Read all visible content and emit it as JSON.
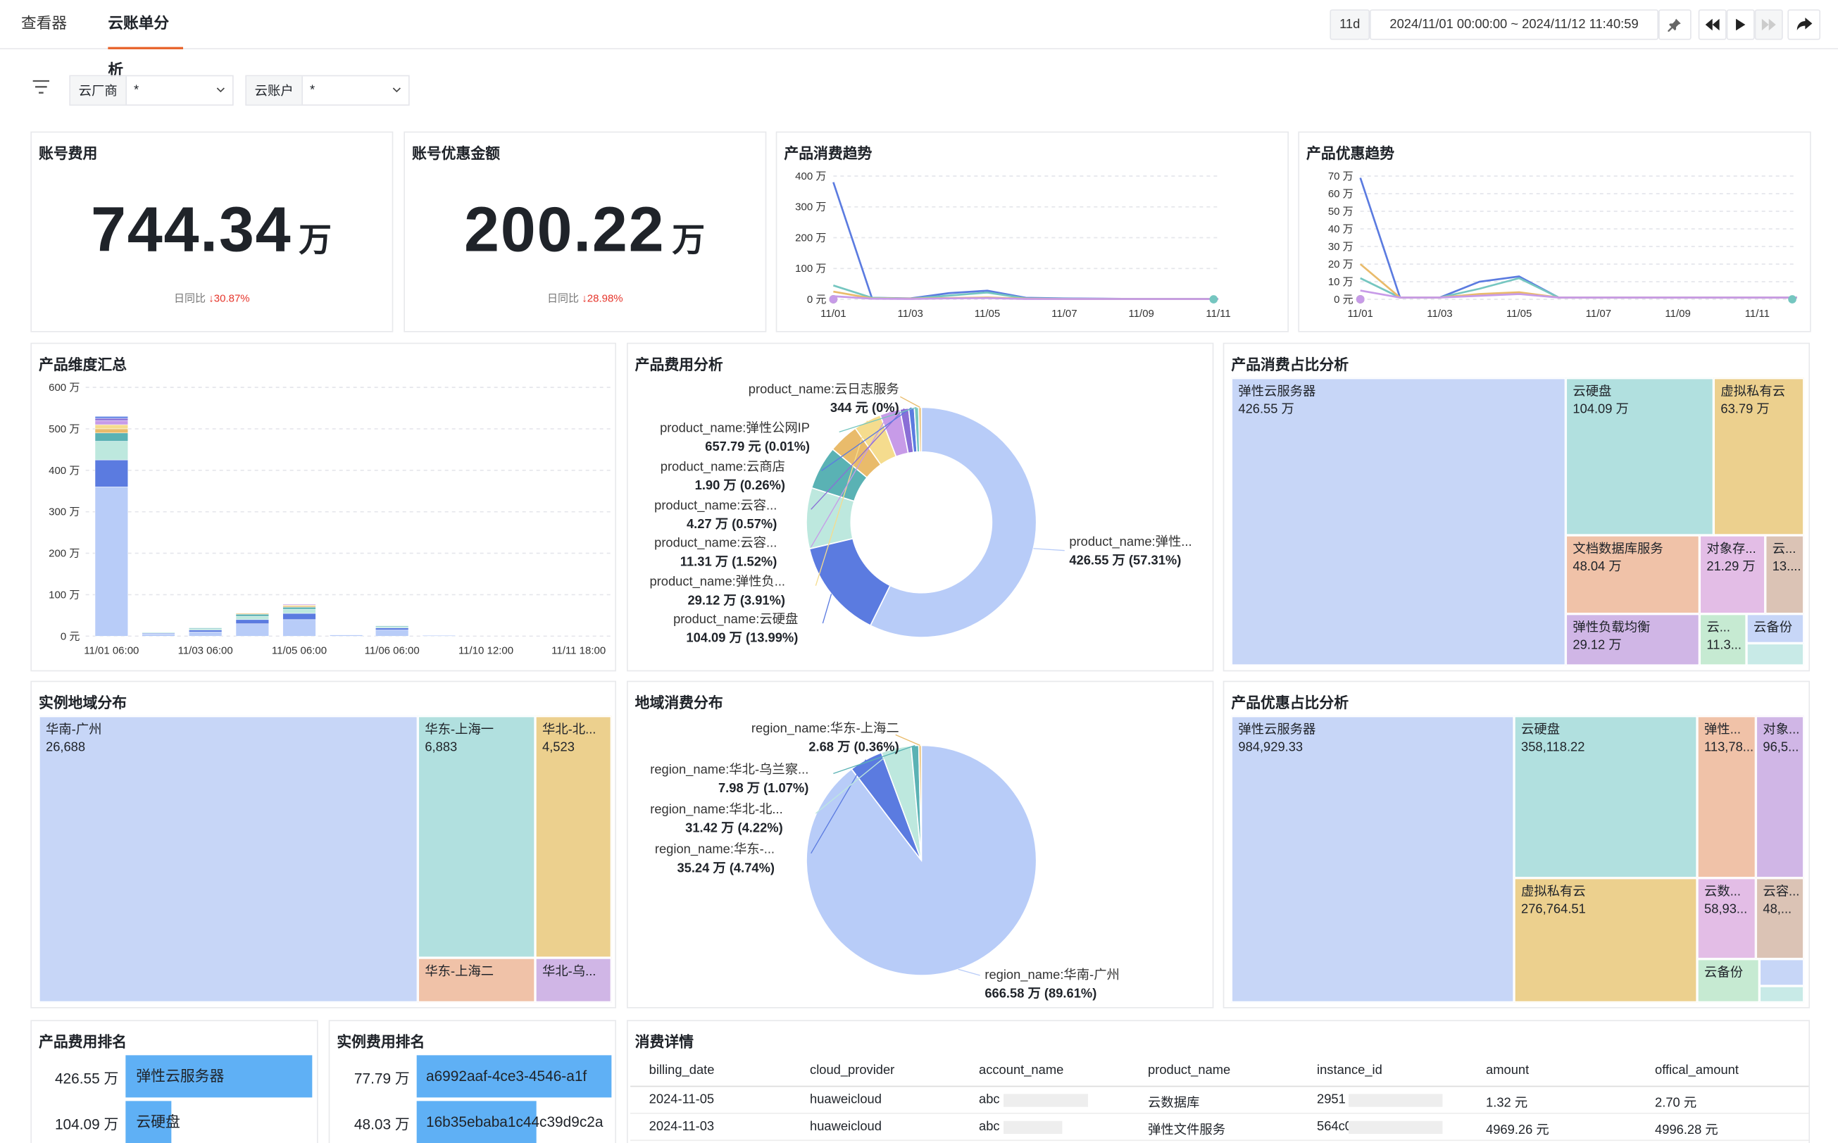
{
  "tabs": [
    {
      "label": "查看器"
    },
    {
      "label": "云账单分析"
    }
  ],
  "toolbar": {
    "range_short": "11d",
    "time_range": "2024/11/01 00:00:00 ~ 2024/11/12 11:40:59"
  },
  "filters": [
    {
      "label": "云厂商",
      "value": "*"
    },
    {
      "label": "云账户",
      "value": "*"
    }
  ],
  "cards": [
    {
      "title": "账号费用",
      "value": "744.34",
      "unit": "万",
      "compare_label": "日同比",
      "compare_value": "30.87%"
    },
    {
      "title": "账号优惠金额",
      "value": "200.22",
      "unit": "万",
      "compare_label": "日同比",
      "compare_value": "28.98%"
    }
  ],
  "panel_titles": {
    "consume_trend": "产品消费趋势",
    "discount_trend": "产品优惠趋势",
    "product_summary": "产品维度汇总",
    "product_cost": "产品费用分析",
    "product_share": "产品消费占比分析",
    "instance_region": "实例地域分布",
    "region_consume": "地域消费分布",
    "discount_share": "产品优惠占比分析",
    "product_rank": "产品费用排名",
    "instance_rank": "实例费用排名",
    "detail": "消费详情"
  },
  "chart_data": [
    {
      "type": "line",
      "title": "产品消费趋势",
      "x_ticks": [
        "11/01",
        "11/03",
        "11/05",
        "11/07",
        "11/09",
        "11/11"
      ],
      "y_ticks": [
        "0 元",
        "100 万",
        "200 万",
        "300 万",
        "400 万"
      ],
      "ylim": [
        0,
        400
      ],
      "x": [
        "11/01",
        "11/02",
        "11/03",
        "11/04",
        "11/05",
        "11/06",
        "11/07",
        "11/08",
        "11/09",
        "11/10",
        "11/11"
      ],
      "series": [
        {
          "color": "#5b7be0",
          "values": [
            380,
            5,
            3,
            20,
            28,
            5,
            3,
            2,
            1,
            1,
            1
          ]
        },
        {
          "color": "#75c6c0",
          "values": [
            45,
            5,
            2,
            12,
            22,
            3,
            2,
            1,
            1,
            1,
            1
          ]
        },
        {
          "color": "#e9bb6b",
          "values": [
            25,
            3,
            2,
            4,
            6,
            2,
            1,
            1,
            1,
            1,
            1
          ]
        },
        {
          "color": "#c79be8",
          "values": [
            10,
            2,
            1,
            3,
            4,
            1,
            1,
            1,
            1,
            1,
            1
          ]
        }
      ]
    },
    {
      "type": "line",
      "title": "产品优惠趋势",
      "x_ticks": [
        "11/01",
        "11/03",
        "11/05",
        "11/07",
        "11/09",
        "11/11"
      ],
      "y_ticks": [
        "0 元",
        "10 万",
        "20 万",
        "30 万",
        "40 万",
        "50 万",
        "60 万",
        "70 万"
      ],
      "ylim": [
        0,
        70
      ],
      "x": [
        "11/01",
        "11/02",
        "11/03",
        "11/04",
        "11/05",
        "11/06",
        "11/07",
        "11/08",
        "11/09",
        "11/10",
        "11/11",
        "11/12"
      ],
      "series": [
        {
          "color": "#5b7be0",
          "values": [
            69,
            1,
            1,
            10,
            13,
            1,
            1,
            1,
            1,
            1,
            1,
            1
          ]
        },
        {
          "color": "#75c6c0",
          "values": [
            12,
            1,
            1,
            6,
            12,
            1,
            1,
            1,
            1,
            1,
            1,
            1
          ]
        },
        {
          "color": "#e9bb6b",
          "values": [
            20,
            1,
            1,
            3,
            4,
            1,
            1,
            1,
            1,
            1,
            1,
            1
          ]
        },
        {
          "color": "#c79be8",
          "values": [
            5,
            1,
            1,
            2,
            3,
            1,
            1,
            1,
            1,
            1,
            1,
            1
          ]
        }
      ]
    },
    {
      "type": "bar",
      "title": "产品维度汇总",
      "x_ticks": [
        "11/01 06:00",
        "11/03 06:00",
        "11/05 06:00",
        "11/06 06:00",
        "11/10 12:00",
        "11/11 18:00"
      ],
      "y_ticks": [
        "0 元",
        "100 万",
        "200 万",
        "300 万",
        "400 万",
        "500 万",
        "600 万"
      ],
      "ylim": [
        0,
        600
      ],
      "stack_colors": [
        "#b8ccf8",
        "#5b7be0",
        "#bde8de",
        "#5ab2b4",
        "#e9bb6b",
        "#f5dc8e",
        "#c79be8",
        "#8a6ed6",
        "#6b8de6"
      ],
      "stacks": [
        [
          360,
          65,
          45,
          20,
          10,
          10,
          10,
          5,
          5
        ],
        [
          5,
          2,
          2,
          0,
          0,
          0,
          0,
          0,
          0
        ],
        [
          10,
          5,
          3,
          2,
          0,
          0,
          0,
          0,
          0
        ],
        [
          30,
          10,
          8,
          5,
          2,
          0,
          0,
          0,
          0
        ],
        [
          40,
          15,
          10,
          5,
          3,
          2,
          2,
          0,
          0
        ],
        [
          3,
          0,
          0,
          0,
          0,
          0,
          0,
          0,
          0
        ],
        [
          15,
          5,
          3,
          2,
          0,
          0,
          0,
          0,
          0
        ],
        [
          2,
          0,
          0,
          0,
          0,
          0,
          0,
          0,
          0
        ]
      ]
    },
    {
      "type": "pie",
      "title": "产品费用分析",
      "donut": true,
      "slices": [
        {
          "label": "product_name:弹性...",
          "value_text": "426.55 万 (57.31%)",
          "pct": 57.31,
          "color": "#b8ccf8"
        },
        {
          "label": "product_name:云硬盘",
          "value_text": "104.09 万 (13.99%)",
          "pct": 13.99,
          "color": "#5b7be0"
        },
        {
          "label": "",
          "value_text": "",
          "pct": 8.55,
          "color": "#bde8de"
        },
        {
          "label": "",
          "value_text": "",
          "pct": 6.12,
          "color": "#5ab2b4"
        },
        {
          "label": "",
          "value_text": "",
          "pct": 4.28,
          "color": "#e9bb6b"
        },
        {
          "label": "product_name:弹性负...",
          "value_text": "29.12 万 (3.91%)",
          "pct": 3.91,
          "color": "#f5dc8e"
        },
        {
          "label": "product_name:云容...",
          "value_text": "11.31 万 (1.52%)",
          "pct": 2.86,
          "color": "#c79be8"
        },
        {
          "label": "product_name:云容...",
          "value_text": "4.27 万 (0.57%)",
          "pct": 1.2,
          "color": "#8a6ed6"
        },
        {
          "label": "product_name:云商店",
          "value_text": "1.90 万 (0.26%)",
          "pct": 0.8,
          "color": "#5b7be0"
        },
        {
          "label": "product_name:弹性公网IP",
          "value_text": "657.79 元 (0.01%)",
          "pct": 0.6,
          "color": "#75c6c0"
        },
        {
          "label": "product_name:云日志服务",
          "value_text": "344 元 (0%)",
          "pct": 0.38,
          "color": "#e9bb6b"
        }
      ]
    },
    {
      "type": "pie",
      "title": "地域消费分布",
      "slices": [
        {
          "label": "region_name:华南-广州",
          "value_text": "666.58 万 (89.61%)",
          "pct": 89.61,
          "color": "#b8ccf8"
        },
        {
          "label": "region_name:华东-...",
          "value_text": "35.24 万 (4.74%)",
          "pct": 4.74,
          "color": "#5b7be0"
        },
        {
          "label": "region_name:华北-北...",
          "value_text": "31.42 万 (4.22%)",
          "pct": 4.22,
          "color": "#bde8de"
        },
        {
          "label": "region_name:华北-乌兰察...",
          "value_text": "7.98 万 (1.07%)",
          "pct": 1.07,
          "color": "#5ab2b4"
        },
        {
          "label": "region_name:华东-上海二",
          "value_text": "2.68 万 (0.36%)",
          "pct": 0.36,
          "color": "#e9bb6b"
        }
      ]
    }
  ],
  "treemap_product": [
    {
      "name": "弹性云服务器",
      "value": "426.55 万",
      "color": "#c7d6f7"
    },
    {
      "name": "云硬盘",
      "value": "104.09 万",
      "color": "#b1e0df"
    },
    {
      "name": "虚拟私有云",
      "value": "63.79 万",
      "color": "#ecd08e"
    },
    {
      "name": "文档数据库服务",
      "value": "48.04 万",
      "color": "#f0c2a8"
    },
    {
      "name": "对象存...",
      "value": "21.29 万",
      "color": "#e3bde6"
    },
    {
      "name": "云...",
      "value": "13....",
      "color": "#dbc3b5"
    },
    {
      "name": "弹性负载均衡",
      "value": "29.12 万",
      "color": "#d0b6e6"
    },
    {
      "name": "云...",
      "value": "11.3...",
      "color": "#c6ead2"
    },
    {
      "name": "云备份",
      "value": "",
      "color": "#c7d6f7"
    },
    {
      "name": "",
      "value": "",
      "color": "#c8eae7"
    }
  ],
  "treemap_region": [
    {
      "name": "华南-广州",
      "value": "26,688",
      "color": "#c7d6f7"
    },
    {
      "name": "华东-上海一",
      "value": "6,883",
      "color": "#b1e0df"
    },
    {
      "name": "华北-北...",
      "value": "4,523",
      "color": "#ecd08e"
    },
    {
      "name": "华东-上海二",
      "value": "",
      "color": "#f0c2a8"
    },
    {
      "name": "华北-乌...",
      "value": "",
      "color": "#d0b6e6"
    }
  ],
  "treemap_discount": [
    {
      "name": "弹性云服务器",
      "value": "984,929.33",
      "color": "#c7d6f7"
    },
    {
      "name": "云硬盘",
      "value": "358,118.22",
      "color": "#b1e0df"
    },
    {
      "name": "弹性...",
      "value": "113,78...",
      "color": "#f0c2a8"
    },
    {
      "name": "对象...",
      "value": "96,5...",
      "color": "#d0b6e6"
    },
    {
      "name": "虚拟私有云",
      "value": "276,764.51",
      "color": "#ecd08e"
    },
    {
      "name": "云数...",
      "value": "58,93...",
      "color": "#e3bde6"
    },
    {
      "name": "云容...",
      "value": "48,...",
      "color": "#dbc3b5"
    },
    {
      "name": "云备份",
      "value": "",
      "color": "#c6ead2"
    },
    {
      "name": "",
      "value": "",
      "color": "#c7d6f7"
    },
    {
      "name": "",
      "value": "",
      "color": "#c8eae7"
    }
  ],
  "product_rank": [
    {
      "amount": "426.55 万",
      "name": "弹性云服务器",
      "fraction": 1.0
    },
    {
      "amount": "104.09 万",
      "name": "云硬盘",
      "fraction": 0.244
    }
  ],
  "instance_rank": [
    {
      "amount": "77.79 万",
      "name": "a6992aaf-4ce3-4546-a1f",
      "fraction": 1.0
    },
    {
      "amount": "48.03 万",
      "name": "16b35ebaba1c44c39d9c2a",
      "fraction": 0.617
    }
  ],
  "detail": {
    "columns": [
      "billing_date",
      "cloud_provider",
      "account_name",
      "product_name",
      "instance_id",
      "amount",
      "offical_amount"
    ],
    "rows": [
      [
        "2024-11-05",
        "huaweicloud",
        "abc",
        "云数据库",
        "2951",
        "1.32 元",
        "2.70 元"
      ],
      [
        "2024-11-03",
        "huaweicloud",
        "abc",
        "弹性文件服务",
        "564c0",
        "4969.26 元",
        "4996.28 元"
      ]
    ]
  }
}
